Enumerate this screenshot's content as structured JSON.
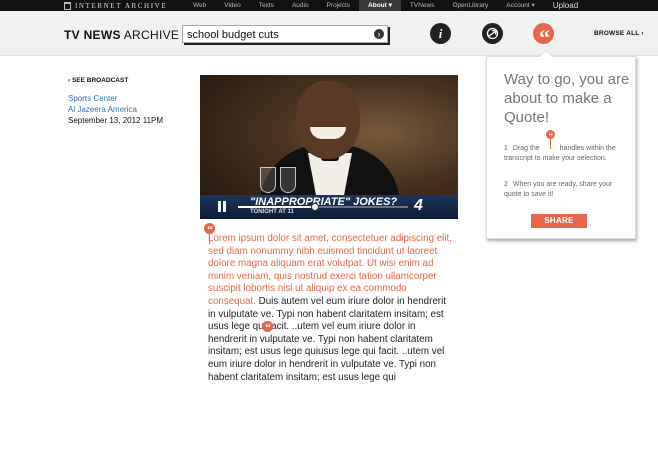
{
  "topbar": {
    "logo_text": "INTERNET ARCHIVE",
    "nav": [
      "Web",
      "Video",
      "Texts",
      "Audio",
      "Projects",
      "About ▾",
      "TVNews",
      "OpenLibrary",
      "Account ▾",
      "Upload"
    ],
    "active_index": 5
  },
  "header": {
    "brand_bold": "TV NEWS",
    "brand_rest": " ARCHIVE",
    "search_value": "school budget cuts",
    "browse_label": "BROWSE ALL ›",
    "info_glyph": "i",
    "quote_glyph": "“"
  },
  "left": {
    "see_broadcast": "‹ SEE BROADCAST",
    "show": "Sports Center",
    "network": "Al Jazeera America",
    "date": "September 13, 2012  11PM"
  },
  "video": {
    "lower_third": "\"INAPPROPRIATE\" JOKES?",
    "lower_sub": "TONIGHT AT 11",
    "channel": "4",
    "progress": 0.45
  },
  "transcript": {
    "selected": "Lorem ipsum dolor sit amet, consectetuer adipiscing elit, sed diam nonummy nibh euismod tincidunt ut laoreet dolore magna aliquam erat volutpat. Ut wisi enim ad minim veniam, quis nostrud exerci tation ullamcorper suscipit lobortis nisl ut aliquip ex ea commodo consequat.",
    "rest": " Duis autem vel eum iriure dolor in hendrerit in vulputate ve. Typi non habent claritatem insitam; est usus lege qui facit. ..utem vel eum iriure dolor in hendrerit in vulputate ve. Typi non habent claritatem insitam; est usus lege quiusus lege qui facit. ..utem vel eum iriure dolor in hendrerit in vulputate ve. Typi non habent claritatem insitam; est usus lege qui"
  },
  "panel": {
    "title": "Way to go, you are about to make a Quote!",
    "step1_num": "1",
    "step1_a": "Drag the",
    "step1_b": "handles within the transcript to make your selection.",
    "step2_num": "2",
    "step2_text": "When you are ready, share your quote to save it!",
    "share_label": "SHARE"
  },
  "colors": {
    "accent": "#e8664a",
    "link": "#3a6fb5",
    "topbar": "#111111",
    "header_bg": "#f1f1f1"
  },
  "icons": [
    "internet-archive-logo-icon",
    "search-go-icon",
    "info-icon",
    "share-icon",
    "quote-icon",
    "pause-icon",
    "quote-handle-icon"
  ]
}
